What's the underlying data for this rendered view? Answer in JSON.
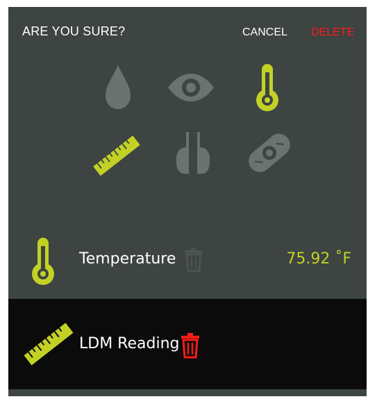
{
  "header": {
    "title": "ARE YOU SURE?",
    "cancel_label": "CANCEL",
    "delete_label": "DELETE"
  },
  "colors": {
    "background": "#3d4442",
    "accent": "#c3d125",
    "danger": "#ff1a1a",
    "inactive_icon": "#6b7270",
    "selected_row": "#0b0b0b"
  },
  "icon_grid": [
    {
      "icon": "water-drop-icon",
      "active": false
    },
    {
      "icon": "eye-icon",
      "active": false
    },
    {
      "icon": "thermometer-icon",
      "active": true
    },
    {
      "icon": "ruler-icon",
      "active": true
    },
    {
      "icon": "probe-pins-icon",
      "active": false
    },
    {
      "icon": "bandage-sensor-icon",
      "active": false
    }
  ],
  "readings": [
    {
      "icon": "thermometer-icon",
      "label": "Temperature",
      "value": "75.92 ˚F"
    },
    {
      "icon": "ruler-icon",
      "label": "LDM Reading",
      "value": ""
    }
  ]
}
